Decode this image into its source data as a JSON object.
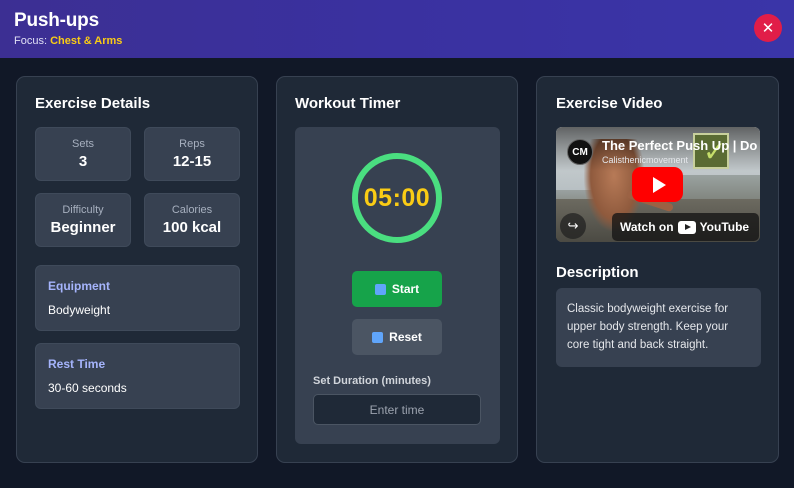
{
  "header": {
    "title": "Push-ups",
    "focus_label": "Focus:",
    "focus_value": "Chest & Arms",
    "close_symbol": "✕"
  },
  "details": {
    "heading": "Exercise Details",
    "stats": [
      {
        "label": "Sets",
        "value": "3"
      },
      {
        "label": "Reps",
        "value": "12-15"
      },
      {
        "label": "Difficulty",
        "value": "Beginner"
      },
      {
        "label": "Calories",
        "value": "100 kcal"
      }
    ],
    "equipment": {
      "label": "Equipment",
      "value": "Bodyweight"
    },
    "rest": {
      "label": "Rest Time",
      "value": "30-60 seconds"
    }
  },
  "timer": {
    "heading": "Workout Timer",
    "display": "05:00",
    "start_label": "Start",
    "reset_label": "Reset",
    "duration_label": "Set Duration (minutes)",
    "duration_placeholder": "Enter time"
  },
  "video": {
    "heading": "Exercise Video",
    "title": "The Perfect Push Up | Do",
    "channel": "Calisthenicmovement",
    "channel_logo": "CM",
    "watch_label": "Watch on",
    "watch_brand": "YouTube",
    "check_mark": "✓"
  },
  "description": {
    "heading": "Description",
    "text": "Classic bodyweight exercise for upper body strength. Keep your core tight and back straight."
  },
  "colors": {
    "header_bg": "#3a31a0",
    "accent_yellow": "#facc15",
    "timer_ring": "#4ade80",
    "start_green": "#16a34a",
    "close_red": "#e11d48",
    "label_indigo": "#a5b4fc"
  }
}
